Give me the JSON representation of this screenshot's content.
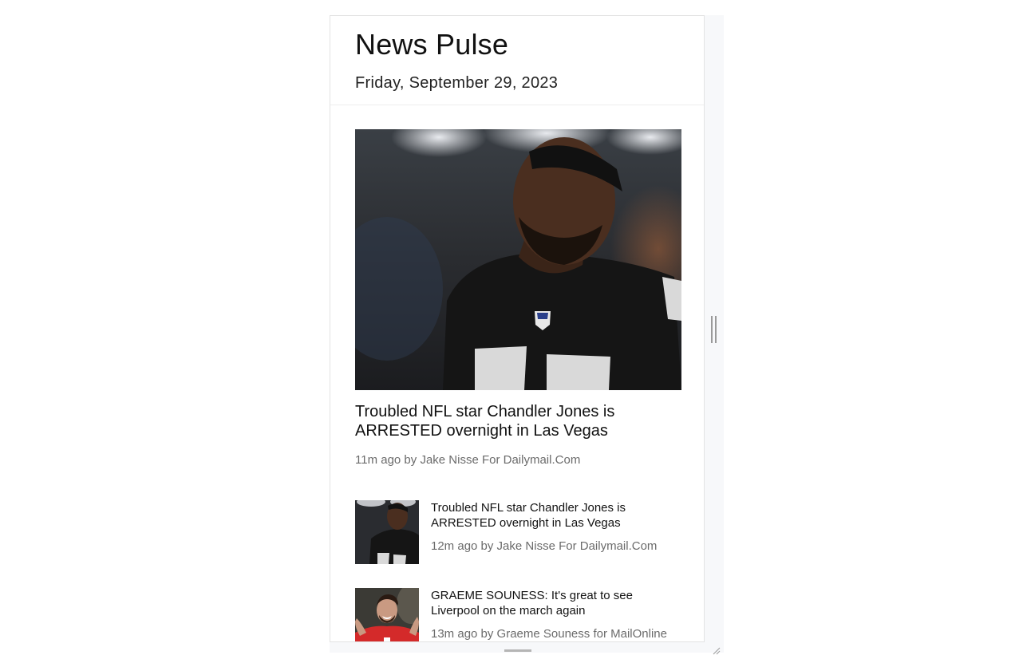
{
  "app": {
    "title": "News Pulse",
    "date": "Friday, September 29, 2023"
  },
  "featured": {
    "title": "Troubled NFL star Chandler Jones is ARRESTED overnight in Las Vegas",
    "meta": "11m ago by Jake Nisse For Dailymail.Com",
    "image_icon": "football-player-photo"
  },
  "articles": [
    {
      "title": "Troubled NFL star Chandler Jones is ARRESTED overnight in Las Vegas",
      "meta": "12m ago by Jake Nisse For Dailymail.Com",
      "image_icon": "football-player-thumbnail"
    },
    {
      "title": "GRAEME SOUNESS: It's great to see Liverpool on the march again",
      "meta": "13m ago by Graeme Souness for MailOnline",
      "image_icon": "soccer-player-thumbnail"
    }
  ],
  "colors": {
    "text": "#111111",
    "meta": "#6b6b6b",
    "divider": "#eeeeee",
    "frame_bg": "#f7f8fa",
    "jersey_dark": "#1a1a1a",
    "jersey_red": "#d42a2a"
  }
}
